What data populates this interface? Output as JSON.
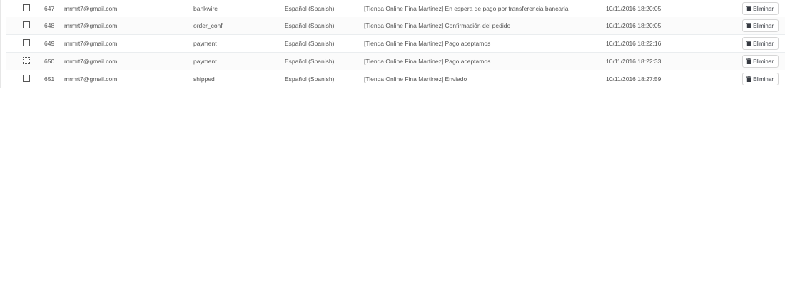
{
  "table": {
    "delete_label": "Eliminar",
    "rows": [
      {
        "id": "647",
        "email": "mrmrt7@gmail.com",
        "template": "bankwire",
        "language": "Español (Spanish)",
        "subject": "[Tienda Online Fina Martinez] En espera de pago por transferencia bancaria",
        "date": "10/11/2016 18:20:05"
      },
      {
        "id": "648",
        "email": "mrmrt7@gmail.com",
        "template": "order_conf",
        "language": "Español (Spanish)",
        "subject": "[Tienda Online Fina Martinez] Confirmación del pedido",
        "date": "10/11/2016 18:20:05"
      },
      {
        "id": "649",
        "email": "mrmrt7@gmail.com",
        "template": "payment",
        "language": "Español (Spanish)",
        "subject": "[Tienda Online Fina Martinez] Pago aceptamos",
        "date": "10/11/2016 18:22:16"
      },
      {
        "id": "650",
        "email": "mrmrt7@gmail.com",
        "template": "payment",
        "language": "Español (Spanish)",
        "subject": "[Tienda Online Fina Martinez] Pago aceptamos",
        "date": "10/11/2016 18:22:33"
      },
      {
        "id": "651",
        "email": "mrmrt7@gmail.com",
        "template": "shipped",
        "language": "Español (Spanish)",
        "subject": "[Tienda Online Fina Martinez] Enviado",
        "date": "10/11/2016 18:27:59"
      }
    ]
  },
  "colors": {
    "text": "#555555",
    "border": "#eaedef",
    "button_border": "#d6d6d6"
  },
  "icons": {
    "delete": "trash-icon"
  }
}
